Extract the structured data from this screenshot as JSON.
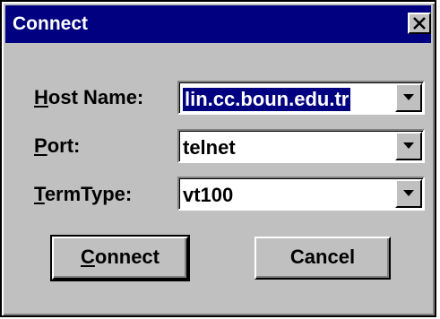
{
  "window": {
    "title": "Connect",
    "close_icon": "close-x-icon"
  },
  "fields": {
    "host": {
      "label_mnemonic": "H",
      "label_rest": "ost Name:",
      "value": "lin.cc.boun.edu.tr"
    },
    "port": {
      "label_mnemonic": "P",
      "label_rest": "ort:",
      "value": "telnet"
    },
    "termtype": {
      "label_mnemonic": "T",
      "label_rest": "ermType:",
      "value": "vt100"
    }
  },
  "buttons": {
    "connect": {
      "mnemonic": "C",
      "rest": "onnect"
    },
    "cancel": {
      "label": "Cancel"
    }
  },
  "colors": {
    "titlebar": "#000080",
    "face": "#c0c0c0",
    "selection": "#000080"
  }
}
